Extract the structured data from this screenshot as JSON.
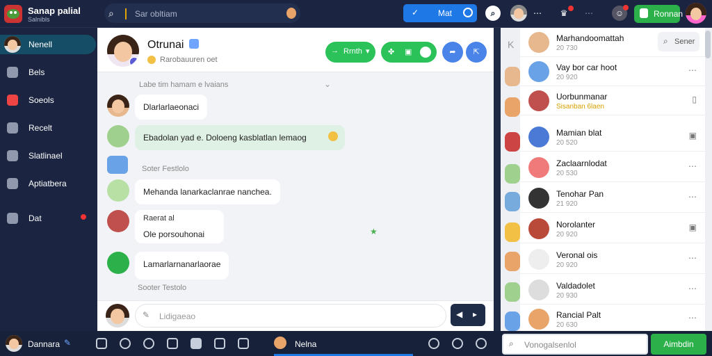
{
  "app": {
    "title": "Sanap palial",
    "subtitle": "Salnibls"
  },
  "top": {
    "search_placeholder": "Sar obltiam",
    "pill_label": "Mat",
    "action_label": "Ronnan"
  },
  "sidebar": {
    "items": [
      {
        "label": "Nenell",
        "active": true
      },
      {
        "label": "Bels"
      },
      {
        "label": "Soeols"
      },
      {
        "label": "Recelt"
      },
      {
        "label": "Slatlinael"
      },
      {
        "label": "Aptiatbera"
      },
      {
        "label": "Dat"
      }
    ],
    "user_name": "Dannara"
  },
  "chat": {
    "name": "Otrunai",
    "status": "Rarobauuren oet",
    "call_label": "Rrnth",
    "top_note": "Labe tim hamam e lvaians",
    "messages": [
      {
        "text": "Dlarlarlaeonaci",
        "green": false
      },
      {
        "text": "Ebadolan yad e. Doloeng kasblatlan lemaog",
        "green": true
      },
      {
        "text": "Mehanda lanarkaclanrae nanchea.",
        "green": false
      },
      {
        "sender": "Raerat al",
        "text": "Ole porsouhonai",
        "green": false
      },
      {
        "text": "Lamarlarnanarlaorae",
        "green": false
      }
    ],
    "labels": [
      "Soter Festlolo",
      "Sooter Testolo"
    ],
    "compose_placeholder": "Lidigaeao"
  },
  "contacts": {
    "search_label": "Sener",
    "items": [
      {
        "name": "Marhandoomattah",
        "sub": "20 730"
      },
      {
        "name": "Vay bor car hoot",
        "sub": "20 920"
      },
      {
        "name": "Uorbunmanar",
        "sub": "Sisanban 6laen"
      },
      {
        "name": "Mamian blat",
        "sub": "20 520"
      },
      {
        "name": "Zaclaarnlodat",
        "sub": "20 530"
      },
      {
        "name": "Tenohar Pan",
        "sub": "21 920"
      },
      {
        "name": "Norolanter",
        "sub": "20 920"
      },
      {
        "name": "Veronal ois",
        "sub": "20 920"
      },
      {
        "name": "Valdadolet",
        "sub": "20 930"
      },
      {
        "name": "Rancial Palt",
        "sub": "20 630"
      }
    ]
  },
  "bottom": {
    "mid_label": "Nelna",
    "input_placeholder": "Vonogalsenlol",
    "button_label": "Aimbdin"
  }
}
